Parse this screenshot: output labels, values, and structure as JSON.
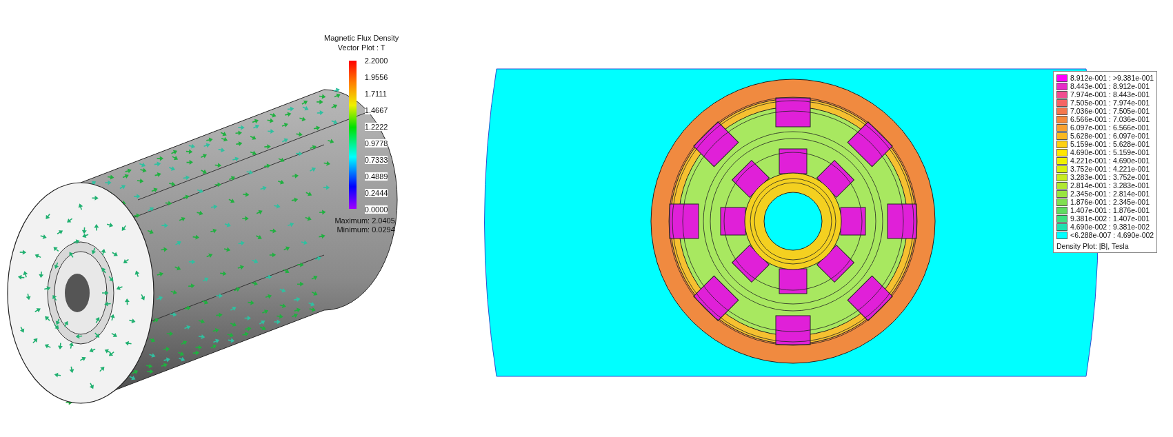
{
  "vector_plot": {
    "title": [
      "Magnetic Flux Density",
      "Vector Plot : T"
    ],
    "scale_labels": [
      "2.2000",
      "1.9556",
      "1.7111",
      "1.4667",
      "1.2222",
      "0.9778",
      "0.7333",
      "0.4889",
      "0.2444",
      "0.0000"
    ],
    "maximum": "Maximum: 2.0405",
    "minimum": "Minimum: 0.0294"
  },
  "density_plot": {
    "legend": [
      {
        "label": "8.912e-001 : >9.381e-001",
        "color": "#ff00ff"
      },
      {
        "label": "8.443e-001 : 8.912e-001",
        "color": "#e82cc8"
      },
      {
        "label": "7.974e-001 : 8.443e-001",
        "color": "#f04c90"
      },
      {
        "label": "7.505e-001 : 7.974e-001",
        "color": "#f56464"
      },
      {
        "label": "7.036e-001 : 7.505e-001",
        "color": "#f5784c"
      },
      {
        "label": "6.566e-001 : 7.036e-001",
        "color": "#f68a3c"
      },
      {
        "label": "6.097e-001 : 6.566e-001",
        "color": "#f8a030"
      },
      {
        "label": "5.628e-001 : 6.097e-001",
        "color": "#fbb820"
      },
      {
        "label": "5.159e-001 : 5.628e-001",
        "color": "#fdd010"
      },
      {
        "label": "4.690e-001 : 5.159e-001",
        "color": "#ffe600"
      },
      {
        "label": "4.221e-001 : 4.690e-001",
        "color": "#f0f000"
      },
      {
        "label": "3.752e-001 : 4.221e-001",
        "color": "#daf010"
      },
      {
        "label": "3.283e-001 : 3.752e-001",
        "color": "#c8ec20"
      },
      {
        "label": "2.814e-001 : 3.283e-001",
        "color": "#b0e830"
      },
      {
        "label": "2.345e-001 : 2.814e-001",
        "color": "#98e440"
      },
      {
        "label": "1.876e-001 : 2.345e-001",
        "color": "#80e050"
      },
      {
        "label": "1.407e-001 : 1.876e-001",
        "color": "#60dc60"
      },
      {
        "label": "9.381e-002 : 1.407e-001",
        "color": "#40e080"
      },
      {
        "label": "4.690e-002 : 9.381e-002",
        "color": "#20e0b0"
      },
      {
        "label": "<6.288e-007 : 4.690e-002",
        "color": "#00ffff"
      }
    ],
    "footer": "Density Plot: |B|, Tesla"
  }
}
